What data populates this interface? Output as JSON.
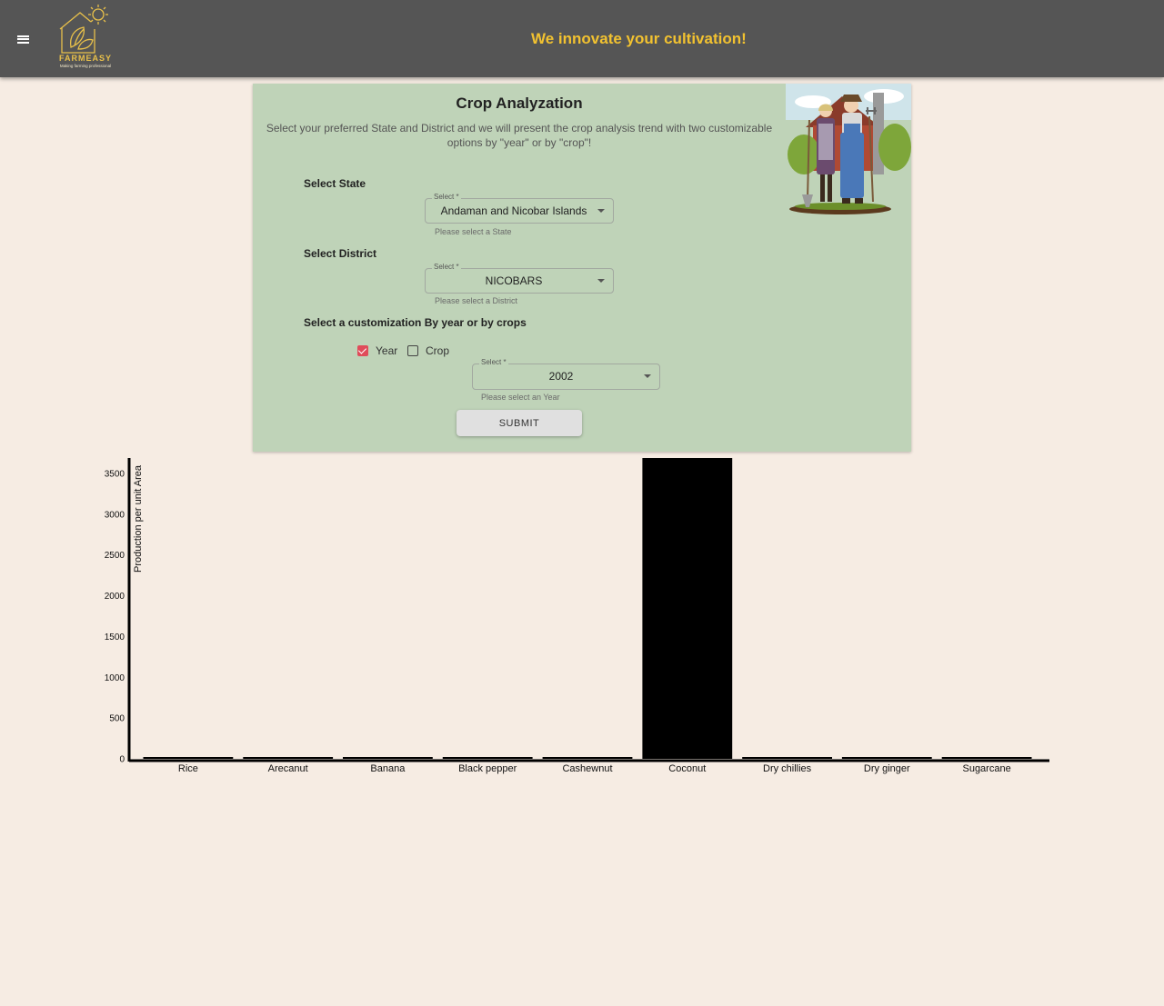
{
  "header": {
    "brand_name": "FARMEASY",
    "brand_tagline": "Making farming professional",
    "tagline": "We innovate your cultivation!",
    "menu_icon": "menu-icon"
  },
  "form": {
    "title": "Crop Analyzation",
    "subtitle": "Select your preferred State and District and we will present the crop analysis trend with two customizable options by \"year\" or by \"crop\"!",
    "state": {
      "label": "Select State",
      "field_legend": "Select *",
      "value": "Andaman and Nicobar Islands",
      "helper": "Please select a State"
    },
    "district": {
      "label": "Select District",
      "field_legend": "Select *",
      "value": "NICOBARS",
      "helper": "Please select a District"
    },
    "customization": {
      "label": "Select a customization By year or by crops",
      "options": [
        {
          "label": "Year",
          "checked": true
        },
        {
          "label": "Crop",
          "checked": false
        }
      ]
    },
    "year": {
      "field_legend": "Select *",
      "value": "2002",
      "helper": "Please select an Year"
    },
    "submit_label": "SUBMIT"
  },
  "chart_data": {
    "type": "bar",
    "title": "",
    "xlabel": "",
    "ylabel": "Production per unit Area",
    "categories": [
      "Rice",
      "Arecanut",
      "Banana",
      "Black pepper",
      "Cashewnut",
      "Coconut",
      "Dry chillies",
      "Dry ginger",
      "Sugarcane"
    ],
    "values": [
      3,
      2,
      8,
      1,
      1,
      3720,
      1,
      2,
      10
    ],
    "ylim": [
      0,
      3700
    ],
    "yticks": [
      0,
      500,
      1000,
      1500,
      2000,
      2500,
      3000,
      3500
    ],
    "ytick_labels": [
      "0",
      "500",
      "1000",
      "1500",
      "2000",
      "2500",
      "3000",
      "3500"
    ],
    "bar_color": "#000000"
  }
}
